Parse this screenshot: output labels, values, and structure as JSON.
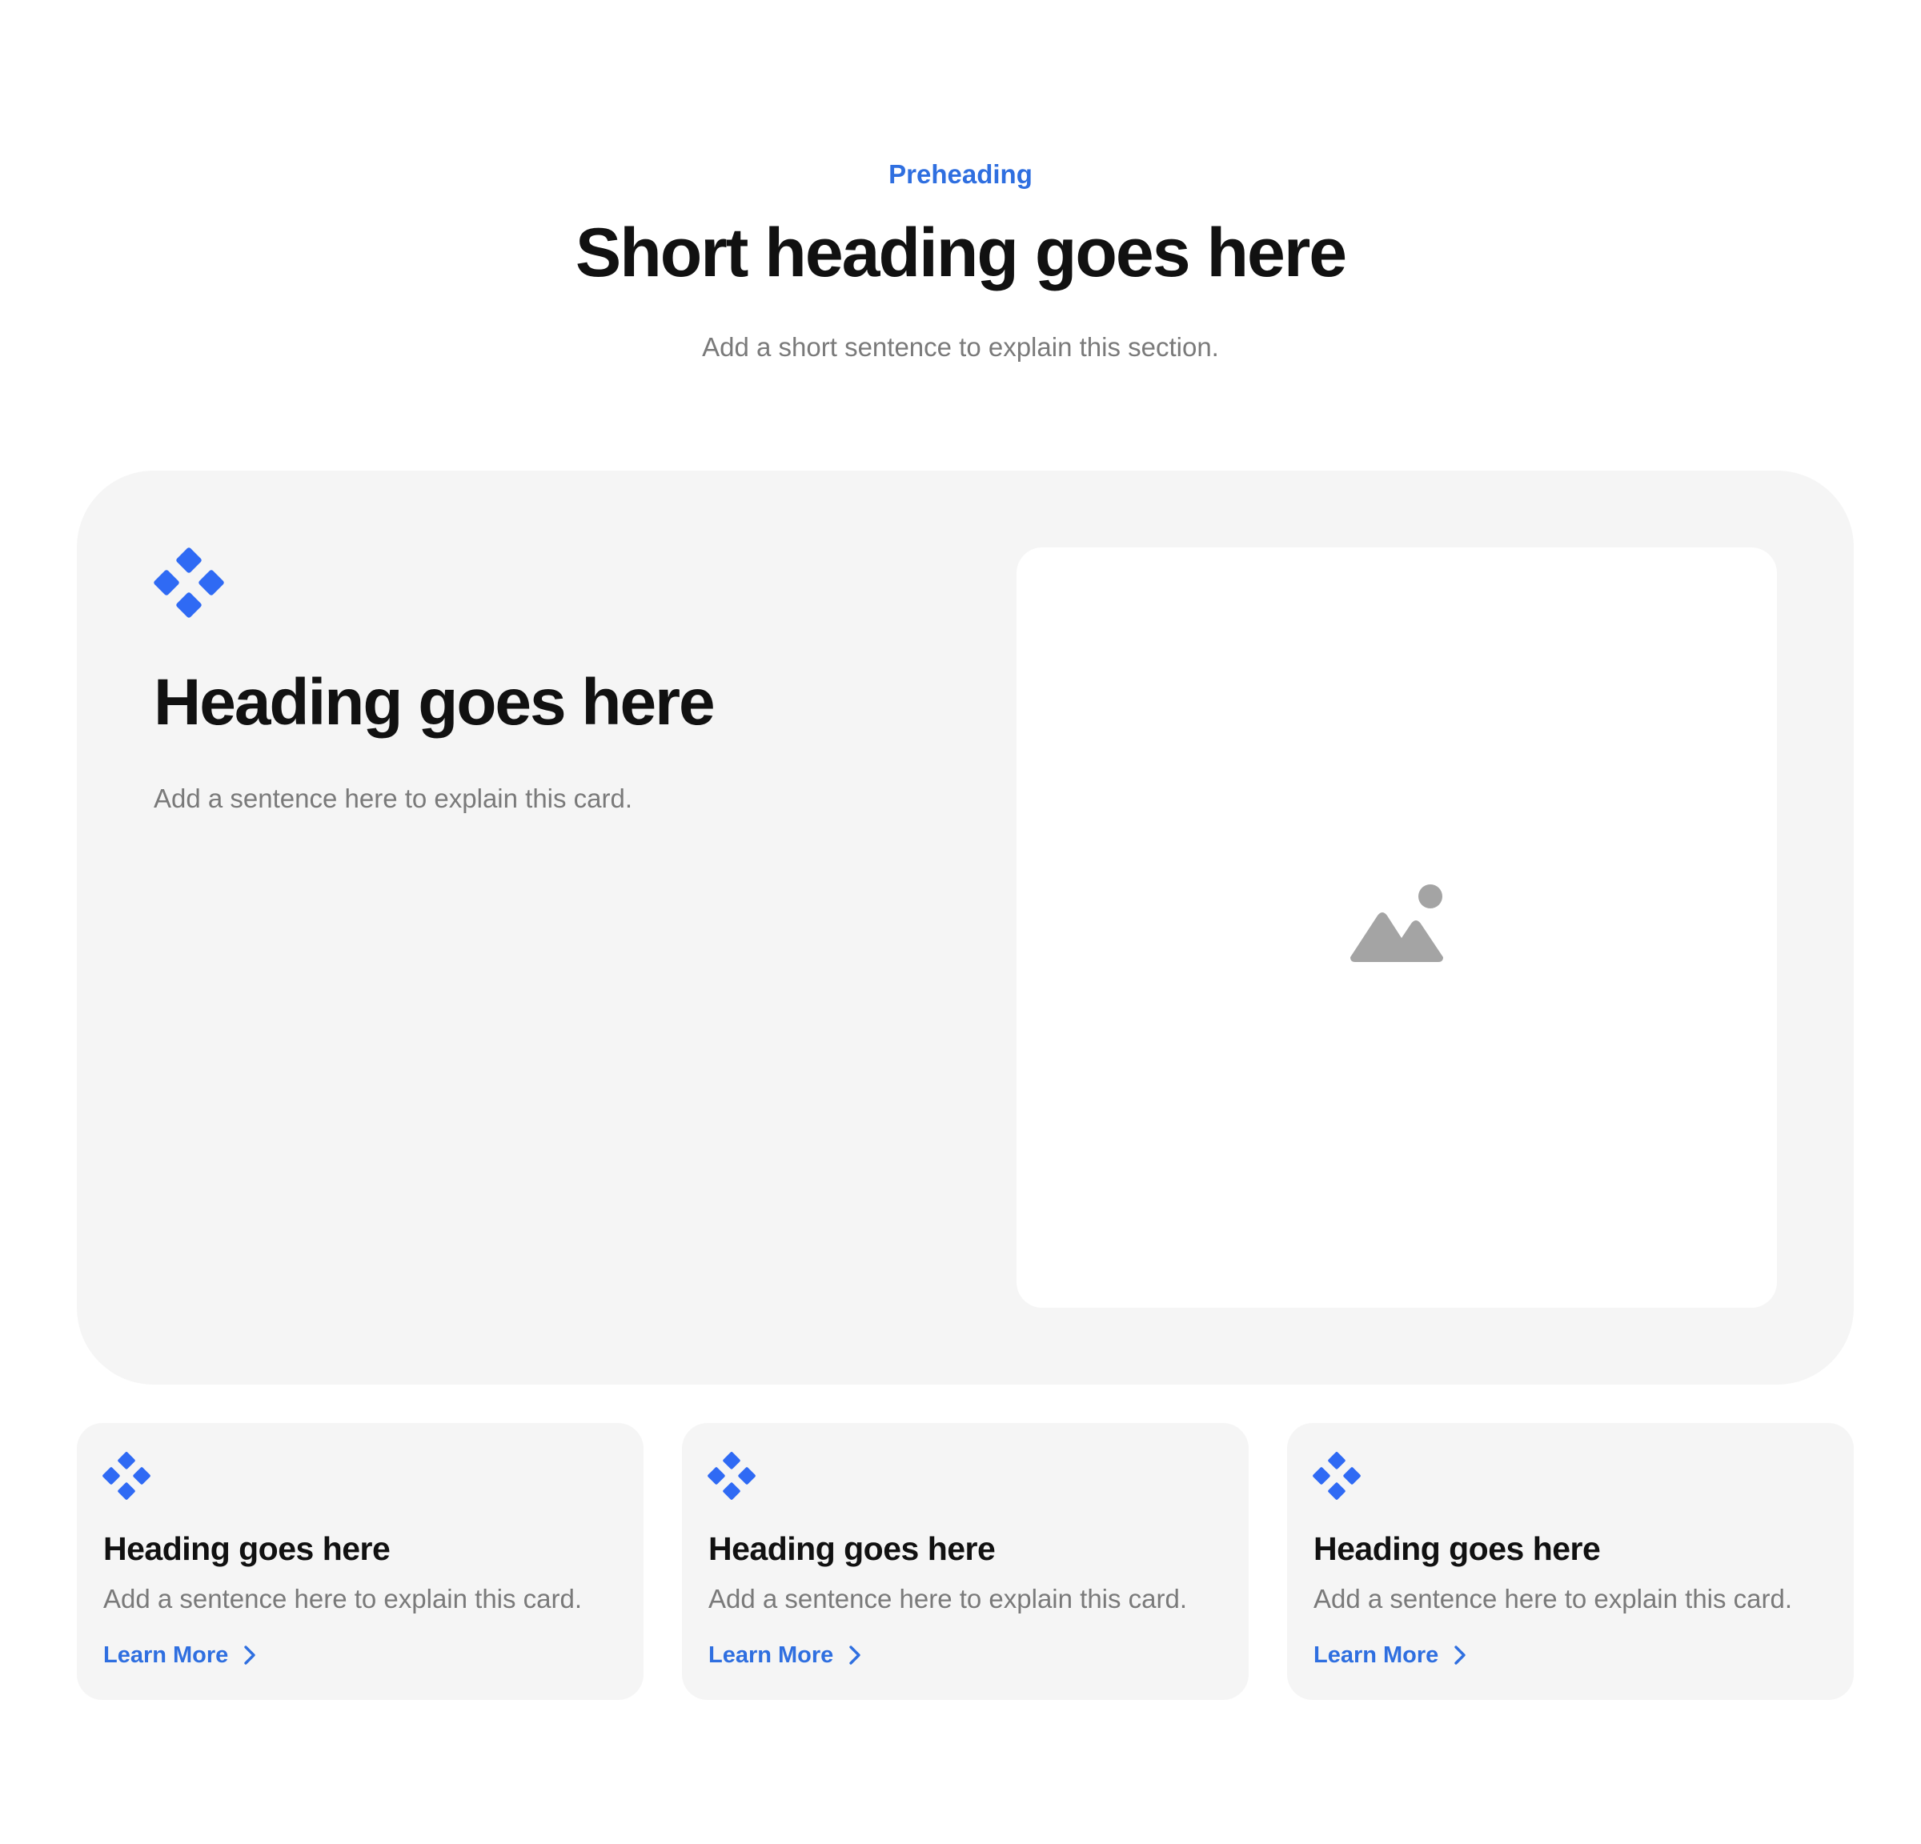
{
  "colors": {
    "accent": "#2f6fe0",
    "icon_blue": "#2f6af4",
    "heading": "#111111",
    "muted_text": "#7a7a7a",
    "card_background": "#f5f5f5",
    "image_icon_gray": "#a4a4a4"
  },
  "section": {
    "preheading": "Preheading",
    "title": "Short heading goes here",
    "subtitle": "Add a short sentence to explain this section."
  },
  "feature_card": {
    "icon": "diamond-cluster-icon",
    "title": "Heading goes here",
    "description": "Add a sentence here to explain this card.",
    "image_icon": "image-placeholder-icon"
  },
  "cards": [
    {
      "icon": "diamond-cluster-icon",
      "title": "Heading goes here",
      "description": "Add a sentence here to explain this card.",
      "link_label": "Learn More",
      "link_icon": "chevron-right-icon"
    },
    {
      "icon": "diamond-cluster-icon",
      "title": "Heading goes here",
      "description": "Add a sentence here to explain this card.",
      "link_label": "Learn More",
      "link_icon": "chevron-right-icon"
    },
    {
      "icon": "diamond-cluster-icon",
      "title": "Heading goes here",
      "description": "Add a sentence here to explain this card.",
      "link_label": "Learn More",
      "link_icon": "chevron-right-icon"
    }
  ]
}
